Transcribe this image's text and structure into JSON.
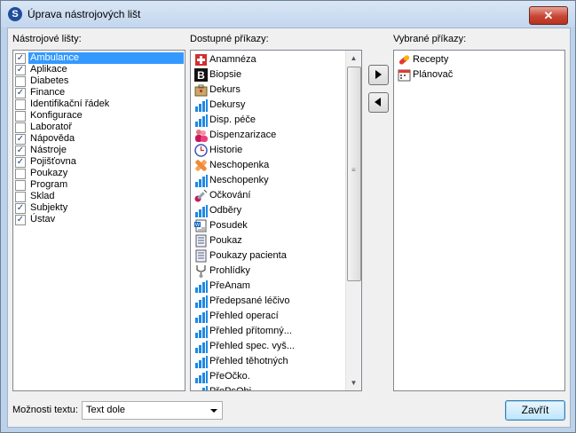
{
  "window": {
    "title": "Úprava nástrojových lišt",
    "app_icon": "S",
    "close_glyph": "✕"
  },
  "toolbars": {
    "label": "Nástrojové lišty:",
    "items": [
      {
        "label": "Ambulance",
        "checked": true,
        "selected": true
      },
      {
        "label": "Aplikace",
        "checked": true
      },
      {
        "label": "Diabetes",
        "checked": false
      },
      {
        "label": "Finance",
        "checked": true
      },
      {
        "label": "Identifikační řádek",
        "checked": false
      },
      {
        "label": "Konfigurace",
        "checked": false
      },
      {
        "label": "Laboratoř",
        "checked": false
      },
      {
        "label": "Nápověda",
        "checked": true
      },
      {
        "label": "Nástroje",
        "checked": true
      },
      {
        "label": "Pojišťovna",
        "checked": true
      },
      {
        "label": "Poukazy",
        "checked": false
      },
      {
        "label": "Program",
        "checked": false
      },
      {
        "label": "Sklad",
        "checked": false
      },
      {
        "label": "Subjekty",
        "checked": true
      },
      {
        "label": "Ústav",
        "checked": true
      }
    ]
  },
  "available": {
    "label": "Dostupné příkazy:",
    "items": [
      {
        "label": "Anamnéza",
        "icon": "red-cross-icon"
      },
      {
        "label": "Biopsie",
        "icon": "letter-b-icon"
      },
      {
        "label": "Dekurs",
        "icon": "briefcase-icon"
      },
      {
        "label": "Dekursy",
        "icon": "bar-chart-icon"
      },
      {
        "label": "Disp. péče",
        "icon": "bar-chart-icon"
      },
      {
        "label": "Dispenzarizace",
        "icon": "people-icon"
      },
      {
        "label": "Historie",
        "icon": "clock-icon"
      },
      {
        "label": "Neschopenka",
        "icon": "bandage-icon"
      },
      {
        "label": "Neschopenky",
        "icon": "bar-chart-icon"
      },
      {
        "label": "Očkování",
        "icon": "syringe-icon"
      },
      {
        "label": "Odběry",
        "icon": "bar-chart-icon"
      },
      {
        "label": "Posudek",
        "icon": "word-doc-icon"
      },
      {
        "label": "Poukaz",
        "icon": "form-icon"
      },
      {
        "label": "Poukazy pacienta",
        "icon": "form-icon"
      },
      {
        "label": "Prohlídky",
        "icon": "stethoscope-icon"
      },
      {
        "label": "PřeAnam",
        "icon": "bar-chart-icon"
      },
      {
        "label": "Předepsané léčivo",
        "icon": "bar-chart-icon"
      },
      {
        "label": "Přehled operací",
        "icon": "bar-chart-icon"
      },
      {
        "label": "Přehled přítomný...",
        "icon": "bar-chart-icon"
      },
      {
        "label": "Přehled spec. vyš...",
        "icon": "bar-chart-icon"
      },
      {
        "label": "Přehled těhotných",
        "icon": "bar-chart-icon"
      },
      {
        "label": "PřeOčko.",
        "icon": "bar-chart-icon"
      },
      {
        "label": "PřePsObj",
        "icon": "bar-chart-icon"
      }
    ]
  },
  "selected": {
    "label": "Vybrané příkazy:",
    "items": [
      {
        "label": "Recepty",
        "icon": "pill-icon"
      },
      {
        "label": "Plánovač",
        "icon": "calendar-icon"
      }
    ]
  },
  "text_options": {
    "label": "Možnosti textu:",
    "value": "Text dole"
  },
  "close_button": {
    "label": "Zavřít"
  },
  "colors": {
    "selection": "#3399ff",
    "chart_icon": "#1e88e5",
    "close_red": "#c74634"
  }
}
